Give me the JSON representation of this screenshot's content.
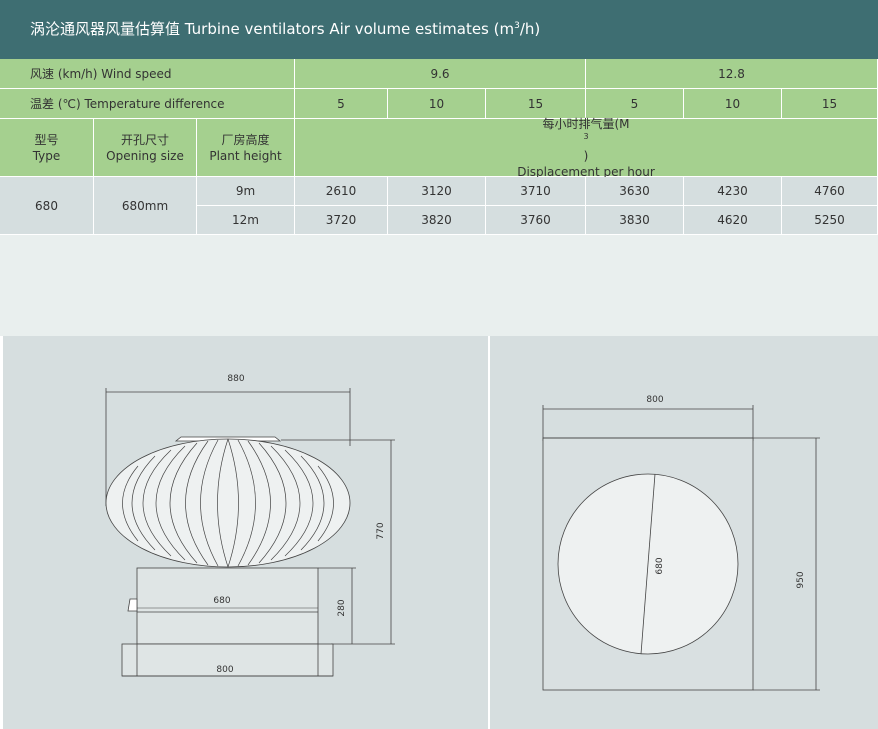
{
  "title": {
    "text": "涡沦通风器风量估算值  Turbine ventilators Air volume estimates  (m",
    "sup": "3",
    "suffix": "/h)"
  },
  "table": {
    "wind_speed": {
      "label": "风速 (km/h)  Wind speed",
      "values": [
        "9.6",
        "12.8"
      ]
    },
    "temperature": {
      "label": "温差 (℃)  Temperature difference",
      "values": [
        "5",
        "10",
        "15",
        "5",
        "10",
        "15"
      ]
    },
    "headers": {
      "type": {
        "cn": "型号",
        "en": "Type"
      },
      "opening": {
        "cn": "开孔尺寸",
        "en": "Opening size"
      },
      "plant": {
        "cn": "厂房高度",
        "en": "Plant height"
      },
      "displacement": {
        "cn": "每小时排气量(M",
        "sup": "3",
        "cn_end": ")",
        "en": "Displacement per hour"
      }
    },
    "model": "680",
    "opening_size": "680mm",
    "rows": [
      {
        "height": "9m",
        "values": [
          "2610",
          "3120",
          "3710",
          "3630",
          "4230",
          "4760"
        ]
      },
      {
        "height": "12m",
        "values": [
          "3720",
          "3820",
          "3760",
          "3830",
          "4620",
          "5250"
        ]
      }
    ]
  },
  "drawings": {
    "side": {
      "width_top": "880",
      "height_total": "770",
      "base_inner": "680",
      "base_height": "280",
      "flange": "800"
    },
    "top": {
      "width": "800",
      "diameter": "680",
      "height": "950"
    }
  }
}
